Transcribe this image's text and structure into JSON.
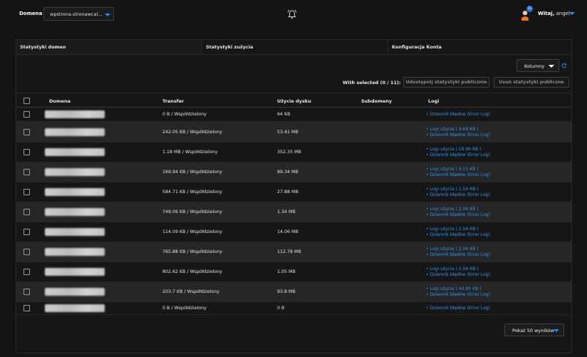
{
  "header": {
    "domain_label": "Domena",
    "domain_value": "wpstrona.stronawcal...",
    "notifications_count": "31",
    "welcome_bold": "Witaj,",
    "welcome_user": "angel",
    "accent_color": "#1e90ff"
  },
  "tabs": [
    {
      "label": "Statystyki domen",
      "active": true
    },
    {
      "label": "Statystyki zużycia",
      "active": false
    },
    {
      "label": "Konfiguracja Konta",
      "active": false
    }
  ],
  "toolbar": {
    "columns_label": "Kolumny",
    "with_selected": "With selected (0 / 11):",
    "share_label": "Udostępnij statystyki publicznie",
    "remove_label": "Usuń statystyki publiczne"
  },
  "table": {
    "columns": [
      "Domena",
      "Transfer",
      "Użycie dysku",
      "Subdomeny",
      "Logi"
    ],
    "rows": [
      {
        "transfer": "0 B / Współdzielony",
        "disk": "64 KB",
        "subdomains": "",
        "logs": [
          "• Dziennik błędów (Error Log)"
        ]
      },
      {
        "transfer": "242.05 KB / Współdzielony",
        "disk": "53.41 MB",
        "subdomains": "",
        "logs": [
          "• Logi użycia ( 4.68 KB )",
          "• Dziennik błędów (Error Log)"
        ]
      },
      {
        "transfer": "1.18 MB / Współdzielony",
        "disk": "352.35 MB",
        "subdomains": "",
        "logs": [
          "• Logi użycia ( 18.96 KB )",
          "• Dziennik błędów (Error Log)"
        ]
      },
      {
        "transfer": "169.94 KB / Współdzielony",
        "disk": "89.34 MB",
        "subdomains": "",
        "logs": [
          "• Logi użycia ( 4.15 KB )",
          "• Dziennik błędów (Error Log)"
        ]
      },
      {
        "transfer": "584.71 KB / Współdzielony",
        "disk": "27.88 MB",
        "subdomains": "",
        "logs": [
          "• Logi użycia ( 2.54 KB )",
          "• Dziennik błędów (Error Log)"
        ]
      },
      {
        "transfer": "748.06 KB / Współdzielony",
        "disk": "1.34 MB",
        "subdomains": "",
        "logs": [
          "• Logi użycia ( 2.56 KB )",
          "• Dziennik błędów (Error Log)"
        ]
      },
      {
        "transfer": "114.09 KB / Współdzielony",
        "disk": "14.06 MB",
        "subdomains": "",
        "logs": [
          "• Logi użycia ( 2.54 KB )",
          "• Dziennik błędów (Error Log)"
        ]
      },
      {
        "transfer": "765.88 KB / Współdzielony",
        "disk": "112.78 MB",
        "subdomains": "",
        "logs": [
          "• Logi użycia ( 2.56 KB )",
          "• Dziennik błędów (Error Log)"
        ]
      },
      {
        "transfer": "802.62 KB / Współdzielony",
        "disk": "1.05 MB",
        "subdomains": "",
        "logs": [
          "• Logi użycia ( 2.56 KB )",
          "• Dziennik błędów (Error Log)"
        ]
      },
      {
        "transfer": "203.7 KB / Współdzielony",
        "disk": "93.8 MB",
        "subdomains": "",
        "logs": [
          "• Logi użycia ( 44.85 KB )",
          "• Dziennik błędów (Error Log)"
        ]
      },
      {
        "transfer": "0 B / Współdzielony",
        "disk": "0 B",
        "subdomains": "",
        "logs": [
          "• Dziennik błędów (Error Log)"
        ]
      }
    ]
  },
  "pagination": {
    "page_size_label": "Pokaż 50 wyników"
  }
}
